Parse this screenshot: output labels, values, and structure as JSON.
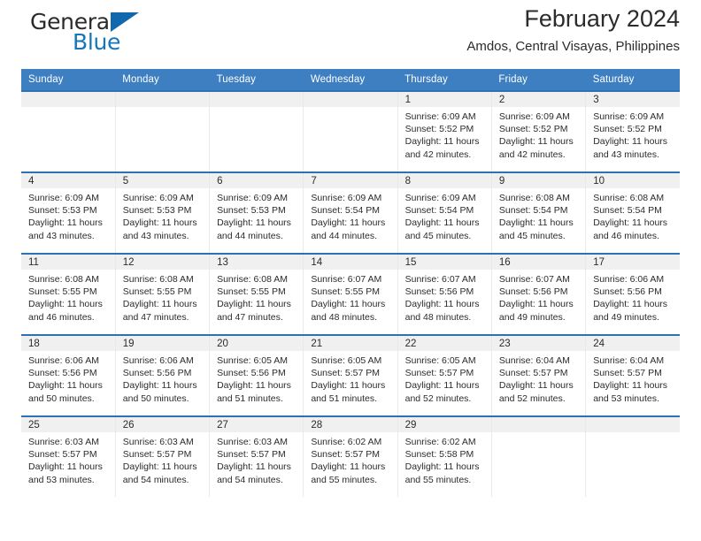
{
  "brand": {
    "name_top": "General",
    "name_bottom": "Blue",
    "accent_color": "#1268ad"
  },
  "header": {
    "title": "February 2024",
    "subtitle": "Amdos, Central Visayas, Philippines"
  },
  "calendar": {
    "header_bg": "#3d7fc1",
    "row_border_color": "#2e72b4",
    "weekdays": [
      "Sunday",
      "Monday",
      "Tuesday",
      "Wednesday",
      "Thursday",
      "Friday",
      "Saturday"
    ],
    "weeks": [
      [
        {
          "day": "",
          "lines": []
        },
        {
          "day": "",
          "lines": []
        },
        {
          "day": "",
          "lines": []
        },
        {
          "day": "",
          "lines": []
        },
        {
          "day": "1",
          "lines": [
            "Sunrise: 6:09 AM",
            "Sunset: 5:52 PM",
            "Daylight: 11 hours",
            "and 42 minutes."
          ]
        },
        {
          "day": "2",
          "lines": [
            "Sunrise: 6:09 AM",
            "Sunset: 5:52 PM",
            "Daylight: 11 hours",
            "and 42 minutes."
          ]
        },
        {
          "day": "3",
          "lines": [
            "Sunrise: 6:09 AM",
            "Sunset: 5:52 PM",
            "Daylight: 11 hours",
            "and 43 minutes."
          ]
        }
      ],
      [
        {
          "day": "4",
          "lines": [
            "Sunrise: 6:09 AM",
            "Sunset: 5:53 PM",
            "Daylight: 11 hours",
            "and 43 minutes."
          ]
        },
        {
          "day": "5",
          "lines": [
            "Sunrise: 6:09 AM",
            "Sunset: 5:53 PM",
            "Daylight: 11 hours",
            "and 43 minutes."
          ]
        },
        {
          "day": "6",
          "lines": [
            "Sunrise: 6:09 AM",
            "Sunset: 5:53 PM",
            "Daylight: 11 hours",
            "and 44 minutes."
          ]
        },
        {
          "day": "7",
          "lines": [
            "Sunrise: 6:09 AM",
            "Sunset: 5:54 PM",
            "Daylight: 11 hours",
            "and 44 minutes."
          ]
        },
        {
          "day": "8",
          "lines": [
            "Sunrise: 6:09 AM",
            "Sunset: 5:54 PM",
            "Daylight: 11 hours",
            "and 45 minutes."
          ]
        },
        {
          "day": "9",
          "lines": [
            "Sunrise: 6:08 AM",
            "Sunset: 5:54 PM",
            "Daylight: 11 hours",
            "and 45 minutes."
          ]
        },
        {
          "day": "10",
          "lines": [
            "Sunrise: 6:08 AM",
            "Sunset: 5:54 PM",
            "Daylight: 11 hours",
            "and 46 minutes."
          ]
        }
      ],
      [
        {
          "day": "11",
          "lines": [
            "Sunrise: 6:08 AM",
            "Sunset: 5:55 PM",
            "Daylight: 11 hours",
            "and 46 minutes."
          ]
        },
        {
          "day": "12",
          "lines": [
            "Sunrise: 6:08 AM",
            "Sunset: 5:55 PM",
            "Daylight: 11 hours",
            "and 47 minutes."
          ]
        },
        {
          "day": "13",
          "lines": [
            "Sunrise: 6:08 AM",
            "Sunset: 5:55 PM",
            "Daylight: 11 hours",
            "and 47 minutes."
          ]
        },
        {
          "day": "14",
          "lines": [
            "Sunrise: 6:07 AM",
            "Sunset: 5:55 PM",
            "Daylight: 11 hours",
            "and 48 minutes."
          ]
        },
        {
          "day": "15",
          "lines": [
            "Sunrise: 6:07 AM",
            "Sunset: 5:56 PM",
            "Daylight: 11 hours",
            "and 48 minutes."
          ]
        },
        {
          "day": "16",
          "lines": [
            "Sunrise: 6:07 AM",
            "Sunset: 5:56 PM",
            "Daylight: 11 hours",
            "and 49 minutes."
          ]
        },
        {
          "day": "17",
          "lines": [
            "Sunrise: 6:06 AM",
            "Sunset: 5:56 PM",
            "Daylight: 11 hours",
            "and 49 minutes."
          ]
        }
      ],
      [
        {
          "day": "18",
          "lines": [
            "Sunrise: 6:06 AM",
            "Sunset: 5:56 PM",
            "Daylight: 11 hours",
            "and 50 minutes."
          ]
        },
        {
          "day": "19",
          "lines": [
            "Sunrise: 6:06 AM",
            "Sunset: 5:56 PM",
            "Daylight: 11 hours",
            "and 50 minutes."
          ]
        },
        {
          "day": "20",
          "lines": [
            "Sunrise: 6:05 AM",
            "Sunset: 5:56 PM",
            "Daylight: 11 hours",
            "and 51 minutes."
          ]
        },
        {
          "day": "21",
          "lines": [
            "Sunrise: 6:05 AM",
            "Sunset: 5:57 PM",
            "Daylight: 11 hours",
            "and 51 minutes."
          ]
        },
        {
          "day": "22",
          "lines": [
            "Sunrise: 6:05 AM",
            "Sunset: 5:57 PM",
            "Daylight: 11 hours",
            "and 52 minutes."
          ]
        },
        {
          "day": "23",
          "lines": [
            "Sunrise: 6:04 AM",
            "Sunset: 5:57 PM",
            "Daylight: 11 hours",
            "and 52 minutes."
          ]
        },
        {
          "day": "24",
          "lines": [
            "Sunrise: 6:04 AM",
            "Sunset: 5:57 PM",
            "Daylight: 11 hours",
            "and 53 minutes."
          ]
        }
      ],
      [
        {
          "day": "25",
          "lines": [
            "Sunrise: 6:03 AM",
            "Sunset: 5:57 PM",
            "Daylight: 11 hours",
            "and 53 minutes."
          ]
        },
        {
          "day": "26",
          "lines": [
            "Sunrise: 6:03 AM",
            "Sunset: 5:57 PM",
            "Daylight: 11 hours",
            "and 54 minutes."
          ]
        },
        {
          "day": "27",
          "lines": [
            "Sunrise: 6:03 AM",
            "Sunset: 5:57 PM",
            "Daylight: 11 hours",
            "and 54 minutes."
          ]
        },
        {
          "day": "28",
          "lines": [
            "Sunrise: 6:02 AM",
            "Sunset: 5:57 PM",
            "Daylight: 11 hours",
            "and 55 minutes."
          ]
        },
        {
          "day": "29",
          "lines": [
            "Sunrise: 6:02 AM",
            "Sunset: 5:58 PM",
            "Daylight: 11 hours",
            "and 55 minutes."
          ]
        },
        {
          "day": "",
          "lines": []
        },
        {
          "day": "",
          "lines": []
        }
      ]
    ]
  }
}
